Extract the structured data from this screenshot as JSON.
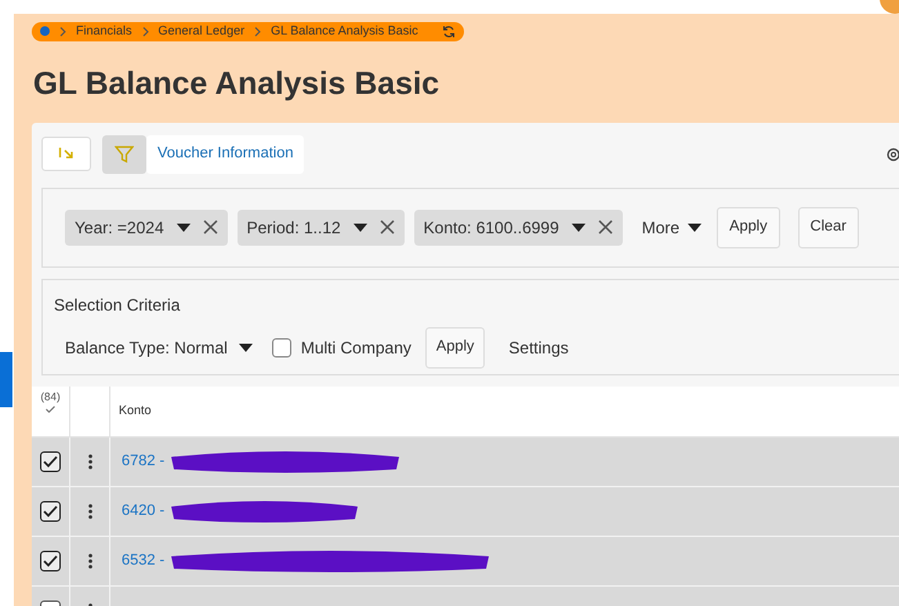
{
  "breadcrumb": [
    "Financials",
    "General Ledger",
    "GL Balance Analysis Basic"
  ],
  "title": "GL Balance Analysis Basic",
  "toolbar": {
    "voucher_link": "Voucher Information"
  },
  "filters": [
    {
      "label": "Year: =2024"
    },
    {
      "label": "Period: 1..12"
    },
    {
      "label": "Konto: 6100..6999"
    }
  ],
  "filter_actions": {
    "more": "More",
    "apply": "Apply",
    "clear": "Clear"
  },
  "selection_criteria": {
    "heading": "Selection Criteria",
    "balance_type": "Balance Type: Normal",
    "multi_company": {
      "label": "Multi Company",
      "checked": false
    },
    "apply": "Apply",
    "settings": "Settings"
  },
  "table": {
    "count": "(84)",
    "columns": [
      "Konto"
    ],
    "rows": [
      {
        "konto": "6782 -",
        "checked": true
      },
      {
        "konto": "6420 -",
        "checked": true
      },
      {
        "konto": "6532 -",
        "checked": true
      },
      {
        "checked": false
      }
    ]
  }
}
